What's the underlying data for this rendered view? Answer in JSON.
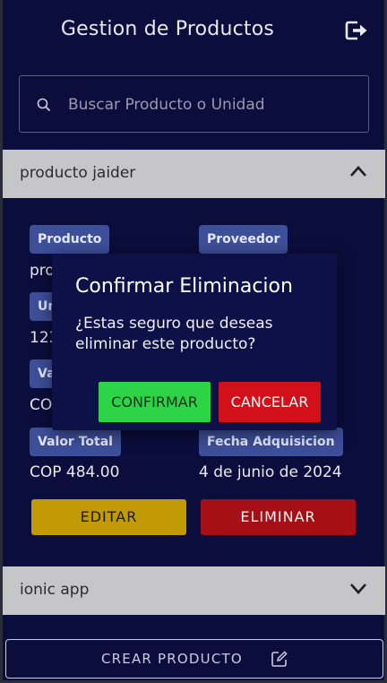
{
  "header": {
    "title": "Gestion de Productos",
    "logout_icon": "logout-icon"
  },
  "search": {
    "placeholder": "Buscar Producto o Unidad",
    "value": ""
  },
  "products": [
    {
      "name": "producto jaider",
      "expanded": true,
      "fields": {
        "producto_label": "Producto",
        "producto_value": "pro",
        "proveedor_label": "Proveedor",
        "unidades_label": "Un",
        "unidades_value": "123",
        "valor_label": "Va",
        "valor_value": "CO",
        "valor_total_label": "Valor Total",
        "valor_total_value": "COP 484.00",
        "fecha_label": "Fecha Adquisicion",
        "fecha_value": "4 de junio de 2024"
      },
      "edit_label": "EDITAR",
      "delete_label": "ELIMINAR"
    },
    {
      "name": "ionic app",
      "expanded": false
    }
  ],
  "create_label": "CREAR PRODUCTO",
  "modal": {
    "title": "Confirmar Eliminacion",
    "message": "¿Estas seguro que deseas eliminar este producto?",
    "confirm_label": "CONFIRMAR",
    "cancel_label": "CANCELAR"
  },
  "colors": {
    "background": "#0b0d3c",
    "badge": "#3e4f9a",
    "edit": "#c29a06",
    "delete": "#a70f16",
    "confirm": "#2ed447",
    "cancel": "#d1101a"
  }
}
